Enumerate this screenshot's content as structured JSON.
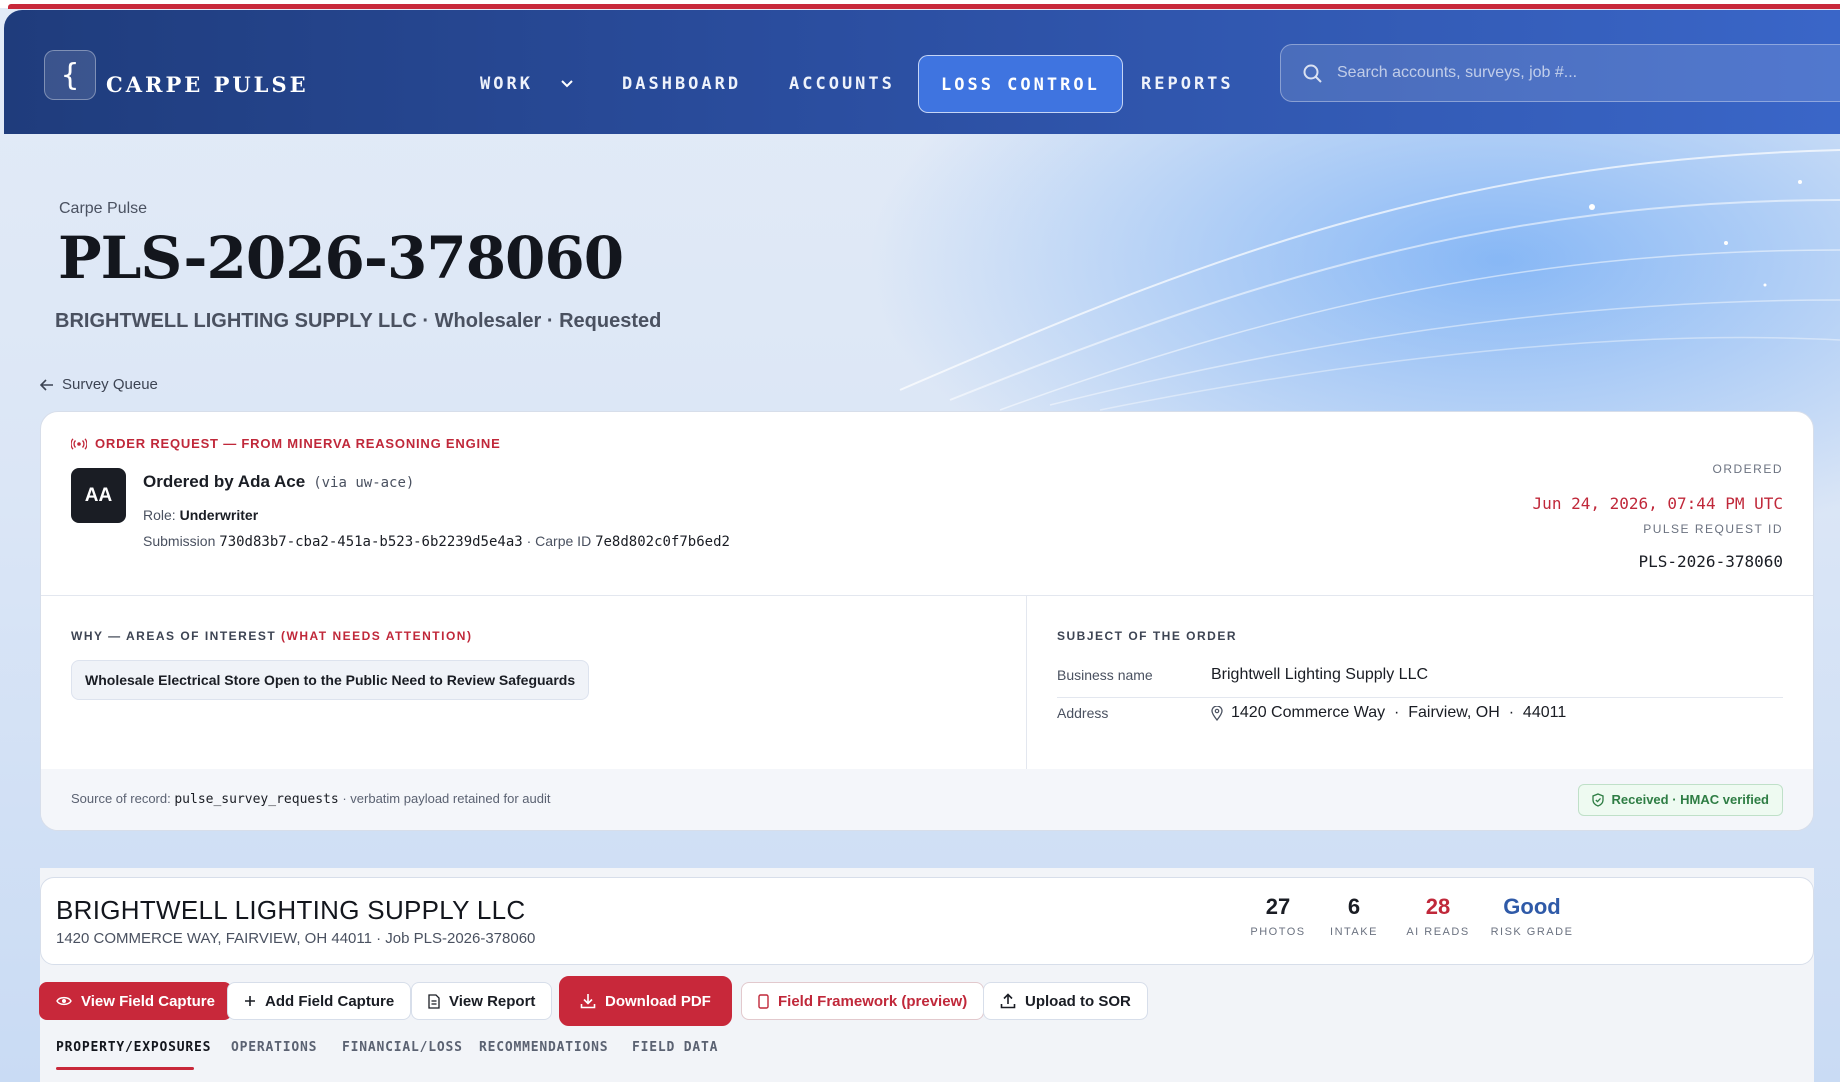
{
  "app": {
    "brand": "CARPE PULSE",
    "logo_glyph": "{"
  },
  "nav": {
    "work": "WORK",
    "dashboard": "DASHBOARD",
    "accounts": "ACCOUNTS",
    "loss_control": "LOSS CONTROL",
    "reports": "REPORTS",
    "search_placeholder": "Search accounts, surveys, job #..."
  },
  "hero": {
    "breadcrumb": "Carpe Pulse",
    "title": "PLS-2026-378060",
    "subtitle": "BRIGHTWELL LIGHTING SUPPLY LLC · Wholesaler · Requested",
    "back_label": "Survey Queue"
  },
  "order": {
    "tag": "ORDER REQUEST — FROM MINERVA REASONING ENGINE",
    "avatar_initials": "AA",
    "ordered_by": "Ordered by Ada Ace",
    "via": "(via uw-ace)",
    "role_label": "Role:",
    "role": "Underwriter",
    "submission_label": "Submission",
    "submission_id": "730d83b7-cba2-451a-b523-6b2239d5e4a3",
    "separator": "·",
    "carpe_id_label": "Carpe ID",
    "carpe_id": "7e8d802c0f7b6ed2",
    "ordered_label": "ORDERED",
    "ordered_date": "Jun 24, 2026, 07:44 PM UTC",
    "pulse_id_label": "PULSE REQUEST ID",
    "pulse_id": "PLS-2026-378060",
    "why_label": "WHY — AREAS OF INTEREST",
    "why_emphasis": "(WHAT NEEDS ATTENTION)",
    "interest_chip": "Wholesale Electrical Store Open to the Public Need to Review Safeguards",
    "subject_label": "SUBJECT OF THE ORDER",
    "business_name_label": "Business name",
    "business_name": "Brightwell Lighting Supply LLC",
    "address_label": "Address",
    "address": "1420 Commerce Way  ·  Fairview, OH  ·  44011",
    "source_prefix": "Source of record:",
    "source_table": "pulse_survey_requests",
    "source_suffix": "· verbatim payload retained for audit",
    "verified": "Received · HMAC verified"
  },
  "summary": {
    "name": "BRIGHTWELL LIGHTING SUPPLY LLC",
    "sub": "1420 COMMERCE WAY, FAIRVIEW, OH 44011  ·  Job PLS-2026-378060",
    "stats": [
      {
        "value": "27",
        "label": "PHOTOS",
        "color": "#1a1d24"
      },
      {
        "value": "6",
        "label": "INTAKE",
        "color": "#1a1d24"
      },
      {
        "value": "28",
        "label": "AI READS",
        "color": "#c0283a"
      },
      {
        "value": "Good",
        "label": "RISK GRADE",
        "color": "#2f5aa8"
      }
    ]
  },
  "actions": {
    "view_field_capture": "View Field Capture",
    "add_field_capture": "Add Field Capture",
    "view_report": "View Report",
    "download_pdf": "Download PDF",
    "field_framework": "Field Framework (preview)",
    "upload_sor": "Upload to SOR"
  },
  "tabs": [
    "PROPERTY/EXPOSURES",
    "OPERATIONS",
    "FINANCIAL/LOSS",
    "RECOMMENDATIONS",
    "FIELD DATA"
  ],
  "colors": {
    "accent_red": "#c8283a",
    "header_blue": "#2b4ea0",
    "active_nav": "#3f74e0",
    "verified_green": "#2e7d44"
  }
}
